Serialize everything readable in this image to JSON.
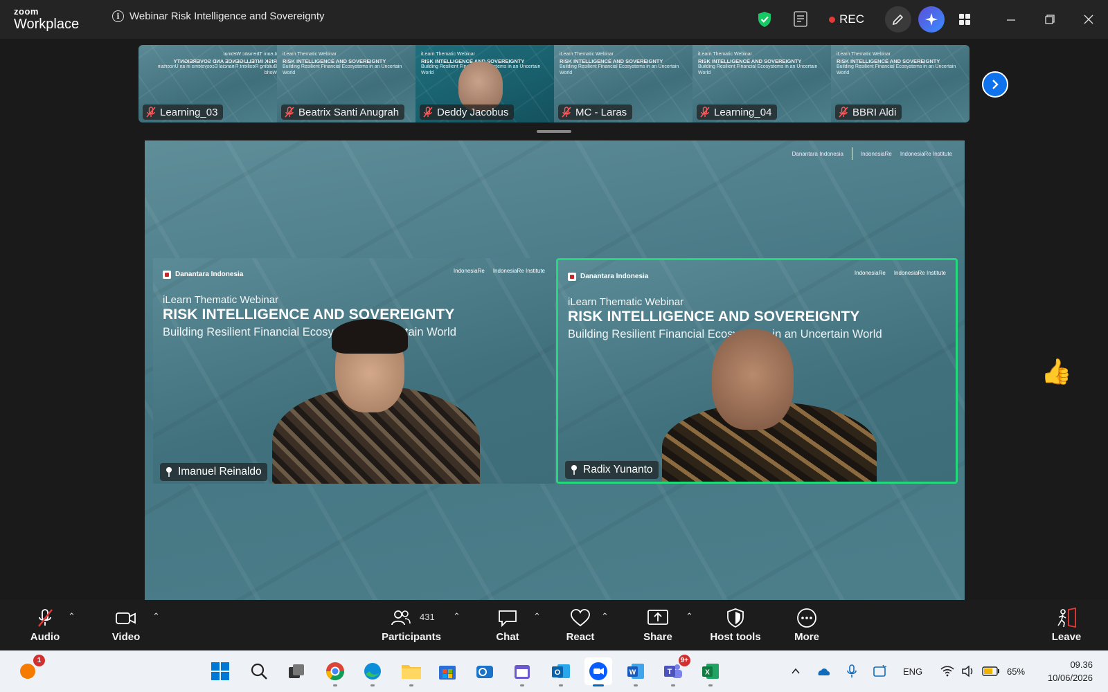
{
  "app": {
    "brand_top": "zoom",
    "brand_bottom": "Workplace"
  },
  "meeting": {
    "title": "Webinar Risk Intelligence and Sovereignty"
  },
  "recording": {
    "label": "REC"
  },
  "filmstrip": {
    "tiles": [
      {
        "name": "Learning_03",
        "muted": true,
        "mirrored": true
      },
      {
        "name": "Beatrix Santi Anugrah",
        "muted": true
      },
      {
        "name": "Deddy Jacobus",
        "muted": true,
        "active": true
      },
      {
        "name": "MC - Laras",
        "muted": true
      },
      {
        "name": "Learning_04",
        "muted": true
      },
      {
        "name": "BBRI Aldi",
        "muted": true
      }
    ],
    "tile_slide": {
      "sub": "iLearn Thematic Webinar",
      "title": "RISK INTELLIGENCE AND SOVEREIGNTY",
      "tag": "Building Resilient Financial Ecosystems in an Uncertain World"
    }
  },
  "stage": {
    "logos": {
      "danantara": "Danantara Indonesia",
      "indonesiare": "IndonesiaRe",
      "institute": "IndonesiaRe Institute"
    },
    "videos": [
      {
        "name": "Imanuel Reinaldo",
        "speaking": false
      },
      {
        "name": "Radix Yunanto",
        "speaking": true
      }
    ],
    "slide": {
      "brand": "Danantara\nIndonesia",
      "sub": "iLearn Thematic Webinar",
      "title": "RISK INTELLIGENCE AND SOVEREIGNTY",
      "tag_left": "Building Resilient Financial Ecosys",
      "tag_left_tail": "an Uncertain World",
      "tag": "Building Resilient Financial Ecosystems in an Uncertain World"
    },
    "reaction": "👍"
  },
  "toolbar": {
    "audio": "Audio",
    "video": "Video",
    "participants": "Participants",
    "participants_count": "431",
    "chat": "Chat",
    "react": "React",
    "share": "Share",
    "host_tools": "Host tools",
    "more": "More",
    "leave": "Leave"
  },
  "taskbar": {
    "notification_badge": "1",
    "teams_badge": "9+",
    "lang": "ENG",
    "battery": "65%",
    "time": "09.36",
    "date": "10/06/2026"
  },
  "colors": {
    "accent": "#0e72ed",
    "speaker_border": "#23d97c",
    "rec": "#e53935",
    "stage": "#4a7b87"
  }
}
